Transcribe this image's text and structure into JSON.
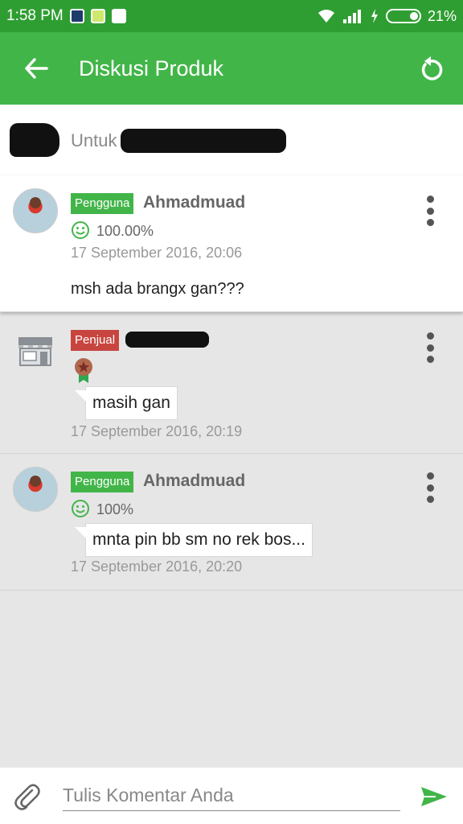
{
  "status_bar": {
    "time": "1:58 PM",
    "battery_pct": "21%",
    "icons": [
      "bbm-icon",
      "phone-notification-icon",
      "mail-icon",
      "wifi-icon",
      "signal-icon",
      "charging-icon",
      "battery-icon"
    ]
  },
  "app_bar": {
    "title": "Diskusi Produk",
    "color": "#42b549",
    "back_icon": "arrow-left-icon",
    "refresh_icon": "refresh-icon"
  },
  "product": {
    "for_label": "Untuk"
  },
  "comments": [
    {
      "role": "Pengguna",
      "username": "Ahmadmuad",
      "reputation": "100.00%",
      "timestamp": "17 September 2016, 20:06",
      "text": "msh ada brangx gan???"
    },
    {
      "role": "Penjual",
      "text": "masih gan",
      "timestamp": "17 September 2016, 20:19"
    },
    {
      "role": "Pengguna",
      "username": "Ahmadmuad",
      "reputation": "100%",
      "text": "mnta pin bb sm no rek bos...",
      "timestamp": "17 September 2016, 20:20"
    }
  ],
  "input_bar": {
    "placeholder": "Tulis Komentar Anda",
    "attach_icon": "paperclip-icon",
    "send_icon": "send-icon"
  },
  "colors": {
    "status_bar": "#2f9e32",
    "accent_green": "#42b549",
    "seller_red": "#c8453f"
  }
}
